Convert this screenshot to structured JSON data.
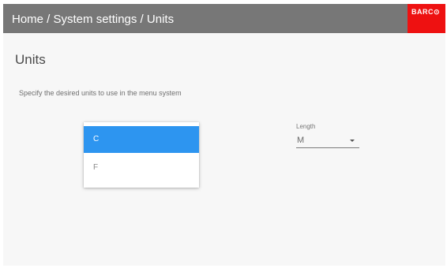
{
  "header": {
    "breadcrumb": "Home / System settings / Units",
    "logo_text": "BARC⊙"
  },
  "main": {
    "title": "Units",
    "description": "Specify the desired units to use in the menu system"
  },
  "temperature_dropdown": {
    "options": [
      "C",
      "F"
    ],
    "selected": "C"
  },
  "length_field": {
    "label": "Length",
    "value": "M"
  },
  "icons": {
    "dropdown_arrow": "caret-down-icon"
  },
  "colors": {
    "header_bg": "#777777",
    "logo_bg": "#ee1111",
    "selected_option_bg": "#2d95f0",
    "page_bg": "#f7f7f7"
  }
}
